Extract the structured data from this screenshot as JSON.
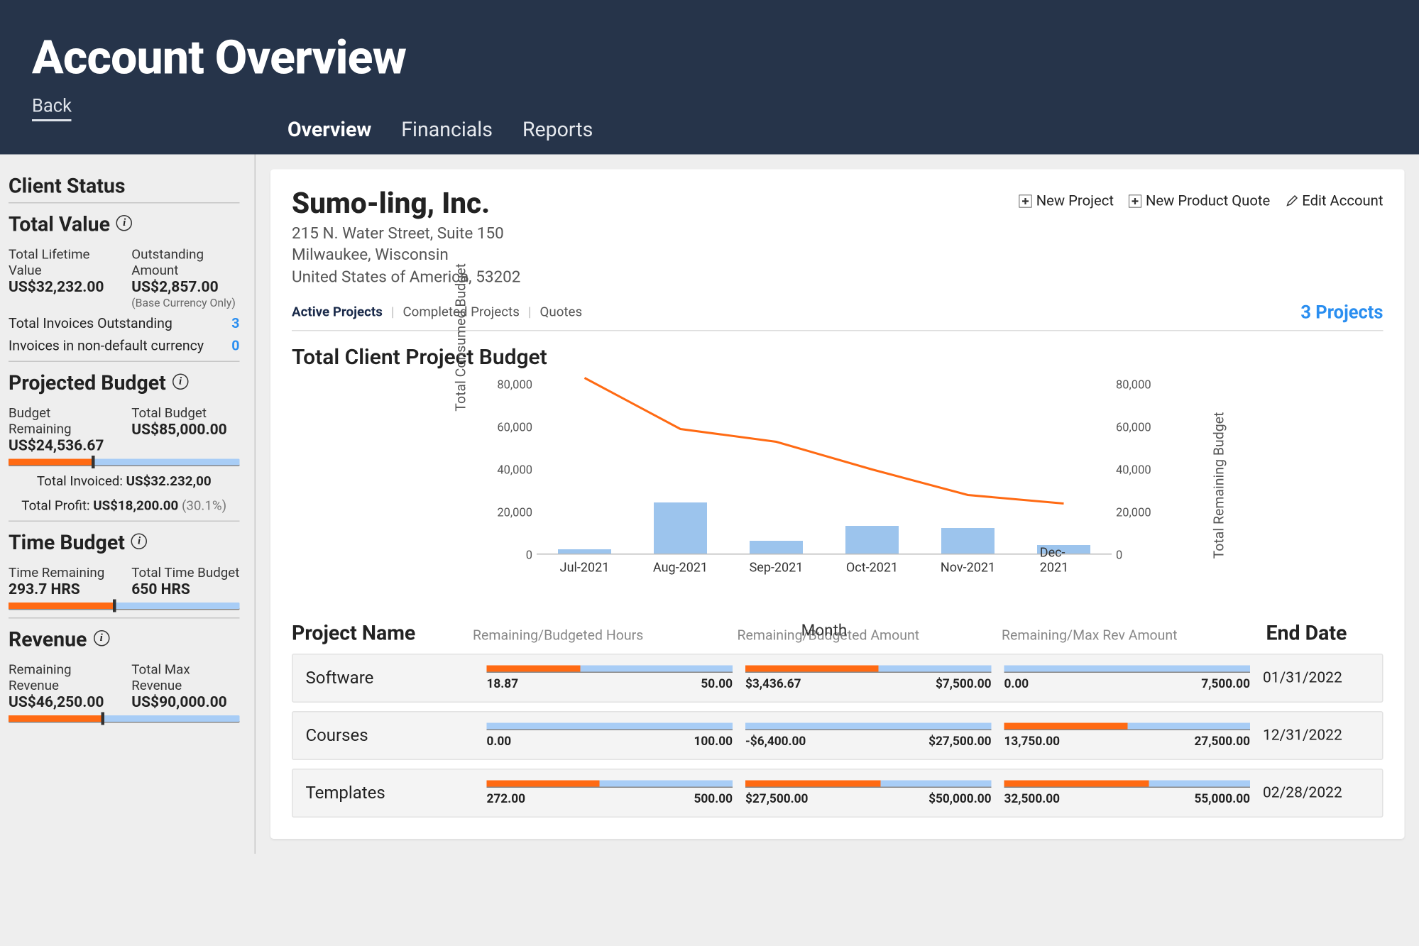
{
  "header": {
    "title": "Account Overview",
    "back": "Back",
    "tabs": {
      "overview": "Overview",
      "financials": "Financials",
      "reports": "Reports"
    }
  },
  "sidebar": {
    "client_status_title": "Client Status",
    "total_value_title": "Total Value",
    "lifetime_label": "Total Lifetime Value",
    "lifetime_value": "US$32,232.00",
    "outstanding_label": "Outstanding Amount",
    "outstanding_value": "US$2,857.00",
    "outstanding_note": "(Base Currency Only)",
    "invoices_outstanding_label": "Total Invoices Outstanding",
    "invoices_outstanding_count": "3",
    "invoices_nondefault_label": "Invoices in non-default currency",
    "invoices_nondefault_count": "0",
    "projected_budget_title": "Projected Budget",
    "budget_remaining_label": "Budget Remaining",
    "budget_remaining_value": "US$24,536.67",
    "total_budget_label": "Total Budget",
    "total_budget_value": "US$85,000.00",
    "budget_fill_pct": 36,
    "total_invoiced_label": "Total Invoiced:",
    "total_invoiced_value": "US$32.232,00",
    "total_profit_label": "Total Profit:",
    "total_profit_value": "US$18,200.00",
    "total_profit_pct": "(30.1%)",
    "time_budget_title": "Time Budget",
    "time_remaining_label": "Time Remaining",
    "time_remaining_value": "293.7 HRS",
    "total_time_label": "Total Time Budget",
    "total_time_value": "650 HRS",
    "time_fill_pct": 45,
    "revenue_title": "Revenue",
    "remaining_revenue_label": "Remaining Revenue",
    "remaining_revenue_value": "US$46,250.00",
    "total_max_revenue_label": "Total Max Revenue",
    "total_max_revenue_value": "US$90,000.00",
    "revenue_fill_pct": 40
  },
  "main": {
    "company": "Sumo-ling, Inc.",
    "addr1": "215 N. Water Street, Suite 150",
    "addr2": "Milwaukee, Wisconsin",
    "addr3": "United States of America, 53202",
    "actions": {
      "new_project": "New Project",
      "new_quote": "New Product Quote",
      "edit_account": "Edit Account"
    },
    "subtabs": {
      "active": "Active Projects",
      "completed": "Completed Projects",
      "quotes": "Quotes"
    },
    "projects_count": "3 Projects",
    "chart_title": "Total Client Project Budget",
    "xlabel": "Month",
    "ylabel_left": "Total Consumed Budget",
    "ylabel_right": "Total Remaining Budget",
    "proj_header": {
      "name": "Project Name",
      "col1": "Remaining/Budgeted Hours",
      "col2": "Remaining/Budgeted Amount",
      "col3": "Remaining/Max Rev Amount",
      "end": "End Date"
    },
    "projects": [
      {
        "name": "Software",
        "hours_rem": "18.87",
        "hours_bud": "50.00",
        "hours_pct": 38,
        "amt_rem": "$3,436.67",
        "amt_bud": "$7,500.00",
        "amt_pct": 54,
        "rev_rem": "0.00",
        "rev_max": "7,500.00",
        "rev_pct": 0,
        "end": "01/31/2022"
      },
      {
        "name": "Courses",
        "hours_rem": "0.00",
        "hours_bud": "100.00",
        "hours_pct": 0,
        "amt_rem": "-$6,400.00",
        "amt_bud": "$27,500.00",
        "amt_pct": 0,
        "rev_rem": "13,750.00",
        "rev_max": "27,500.00",
        "rev_pct": 50,
        "end": "12/31/2022"
      },
      {
        "name": "Templates",
        "hours_rem": "272.00",
        "hours_bud": "500.00",
        "hours_pct": 46,
        "amt_rem": "$27,500.00",
        "amt_bud": "$50,000.00",
        "amt_pct": 55,
        "rev_rem": "32,500.00",
        "rev_max": "55,000.00",
        "rev_pct": 59,
        "end": "02/28/2022"
      }
    ]
  },
  "chart_data": {
    "type": "bar+line",
    "categories": [
      "Jul-2021",
      "Aug-2021",
      "Sep-2021",
      "Oct-2021",
      "Nov-2021",
      "Dec-2021"
    ],
    "yticks": [
      0,
      20000,
      40000,
      60000,
      80000
    ],
    "ylim": [
      0,
      85000
    ],
    "series": [
      {
        "name": "Total Consumed Budget",
        "kind": "bar",
        "values": [
          2000,
          24000,
          6000,
          13000,
          12000,
          4000
        ]
      },
      {
        "name": "Total Remaining Budget",
        "kind": "line",
        "values": [
          83000,
          59000,
          53000,
          40000,
          28000,
          24000
        ]
      }
    ],
    "xlabel": "Month",
    "ylabel_left": "Total Consumed Budget",
    "ylabel_right": "Total Remaining Budget"
  }
}
